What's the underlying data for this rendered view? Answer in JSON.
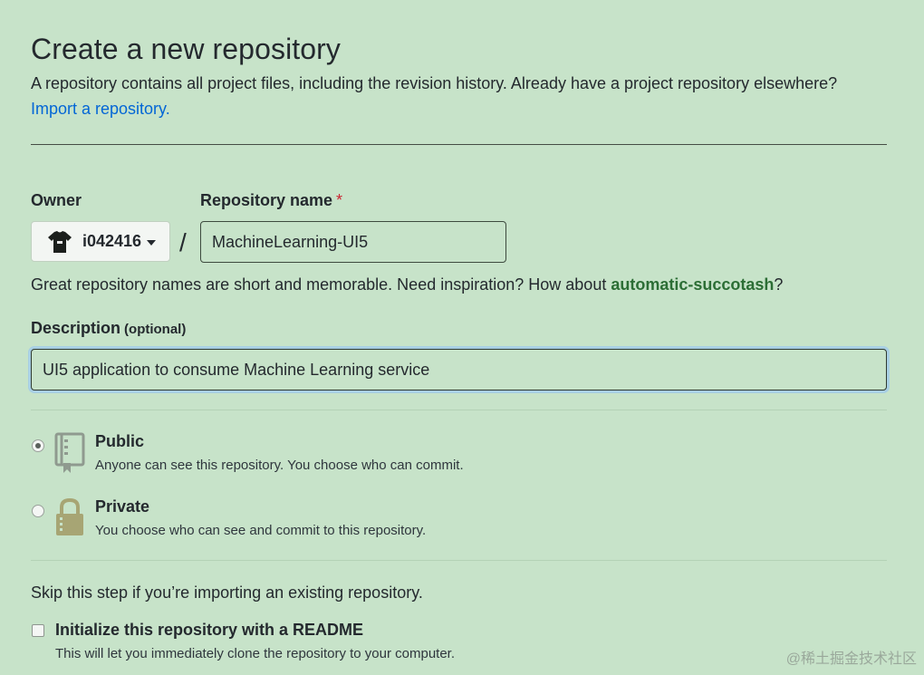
{
  "header": {
    "title": "Create a new repository",
    "subtitle": "A repository contains all project files, including the revision history. Already have a project repository elsewhere?",
    "import_link": "Import a repository."
  },
  "owner": {
    "label": "Owner",
    "name": "i042416",
    "avatar_icon": "tshirt-avatar-icon"
  },
  "repo_name": {
    "label": "Repository name",
    "required_mark": "*",
    "value": "MachineLearning-UI5",
    "separator": "/"
  },
  "hint": {
    "text": "Great repository names are short and memorable. Need inspiration? How about ",
    "suggestion": "automatic-succotash",
    "suffix": "?"
  },
  "description": {
    "label": "Description",
    "optional": "(optional)",
    "value": "UI5 application to consume Machine Learning service"
  },
  "visibility": {
    "public": {
      "title": "Public",
      "desc": "Anyone can see this repository. You choose who can commit.",
      "checked": true,
      "icon": "repo-book-icon"
    },
    "private": {
      "title": "Private",
      "desc": "You choose who can see and commit to this repository.",
      "checked": false,
      "icon": "lock-icon"
    }
  },
  "init": {
    "skip_text": "Skip this step if you’re importing an existing repository.",
    "readme_title": "Initialize this repository with a README",
    "readme_desc": "This will let you immediately clone the repository to your computer."
  },
  "watermark": "@稀土掘金技术社区",
  "colors": {
    "background": "#c7e3c9",
    "link": "#0366d6",
    "suggestion": "#2c6e35",
    "required": "#cb2431",
    "focus_ring": "#a8cfe3"
  }
}
